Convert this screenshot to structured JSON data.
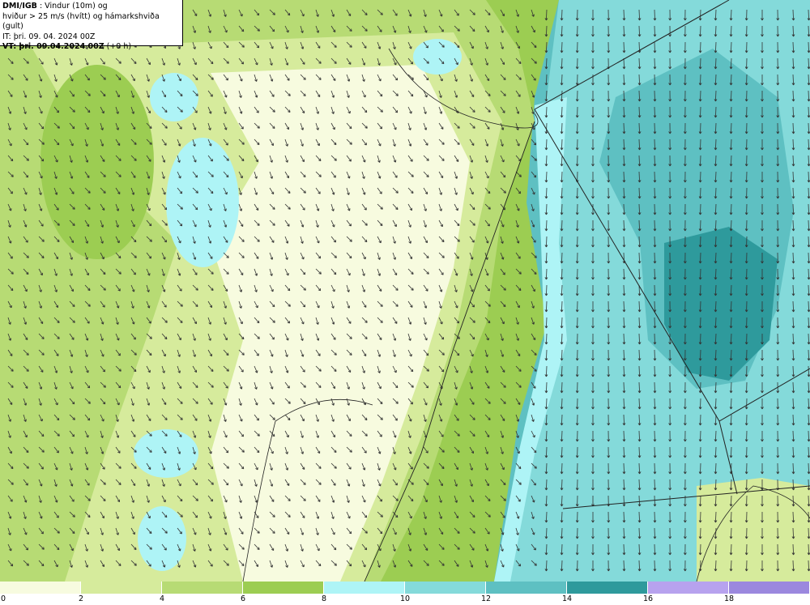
{
  "info_box": {
    "source": "DMI/IGB",
    "line1_rest": " : Vindur (10m) og",
    "line2": "hviður > 25 m/s (hvítt) og hámarkshviða (gult)",
    "line3": "IT: þri. 09. 04. 2024 00Z",
    "line4_label": "VT: þri. 09.04.2024 00Z",
    "line4_rest": " (+0 h)"
  },
  "legend": {
    "colors": [
      "#f7fbdf",
      "#d6eb9c",
      "#b7db74",
      "#9ccd52",
      "#aef4f6",
      "#84dada",
      "#5ec0c2",
      "#2e9a9c",
      "#b7a2ee",
      "#9b88de"
    ],
    "labels": [
      "0",
      "2",
      "4",
      "6",
      "8",
      "10",
      "12",
      "14",
      "16",
      "18"
    ]
  },
  "map_colors": {
    "land_light": "#f7fbdf",
    "land_mid": "#d6eb9c",
    "land_green": "#b7db74",
    "sea_green": "#9ccd52",
    "cyan": "#aef4f6",
    "teal_light": "#84dada",
    "teal": "#5ec0c2",
    "teal_dark": "#2e9a9c"
  }
}
